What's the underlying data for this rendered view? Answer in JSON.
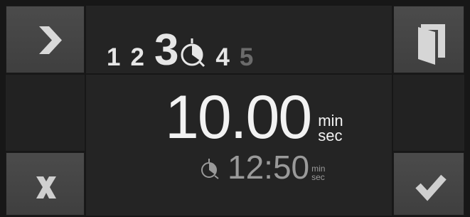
{
  "steps": [
    {
      "label": "1",
      "state": "normal"
    },
    {
      "label": "2",
      "state": "normal"
    },
    {
      "label": "3",
      "state": "active"
    },
    {
      "label": "4",
      "state": "normal"
    },
    {
      "label": "5",
      "state": "dimmed"
    }
  ],
  "timer": {
    "value": "10.00",
    "unit_min": "min",
    "unit_sec": "sec"
  },
  "end_time": {
    "value": "12:50",
    "unit_min": "min",
    "unit_sec": "sec",
    "icon": "timer-icon"
  },
  "buttons": {
    "next": {
      "icon": "chevron-right-icon"
    },
    "book": {
      "icon": "book-icon"
    },
    "cancel": {
      "icon": "close-icon"
    },
    "confirm": {
      "icon": "checkmark-icon"
    }
  },
  "colors": {
    "background": "#171717",
    "button": "#474747",
    "panel": "#242424",
    "text_primary": "#f2f2f2",
    "text_secondary": "#9a9a9a",
    "step_dimmed": "#6b6b6b"
  }
}
